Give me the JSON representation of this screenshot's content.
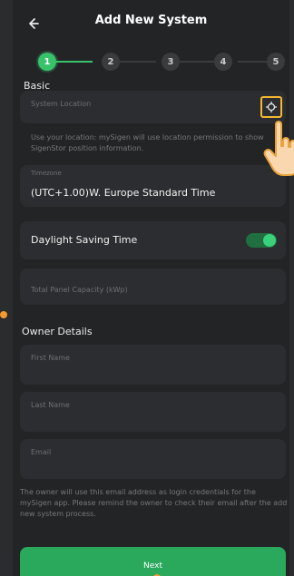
{
  "header": {
    "title": "Add New System",
    "back_icon": "arrow-left-icon"
  },
  "stepper": {
    "steps": [
      "1",
      "2",
      "3",
      "4",
      "5"
    ],
    "active_step": 1,
    "accent": "#38c26c"
  },
  "basic": {
    "section_label": "Basic",
    "system_location": {
      "placeholder": "System Location",
      "icon": "crosshair-icon"
    },
    "location_hint": "Use your location: mySigen will use location permission to show SigenStor position information.",
    "timezone": {
      "label": "Timezone",
      "value": "(UTC+1.00)W. Europe Standard Time"
    },
    "daylight_saving": {
      "label": "Daylight Saving Time",
      "enabled": true
    },
    "panel_capacity": {
      "placeholder": "Total Panel Capacity (kWp)"
    }
  },
  "owner": {
    "section_label": "Owner Details",
    "first_name": {
      "placeholder": "First Name"
    },
    "last_name": {
      "placeholder": "Last Name"
    },
    "email": {
      "placeholder": "Email"
    },
    "hint": "The owner will use this email address as login credentials for the mySigen app. Please remind the owner to check their email after the add new system process."
  },
  "footer": {
    "next_label": "Next"
  },
  "colors": {
    "background": "#232426",
    "field": "#2c2d30",
    "accent": "#38c26c",
    "highlight": "#f5b731"
  }
}
